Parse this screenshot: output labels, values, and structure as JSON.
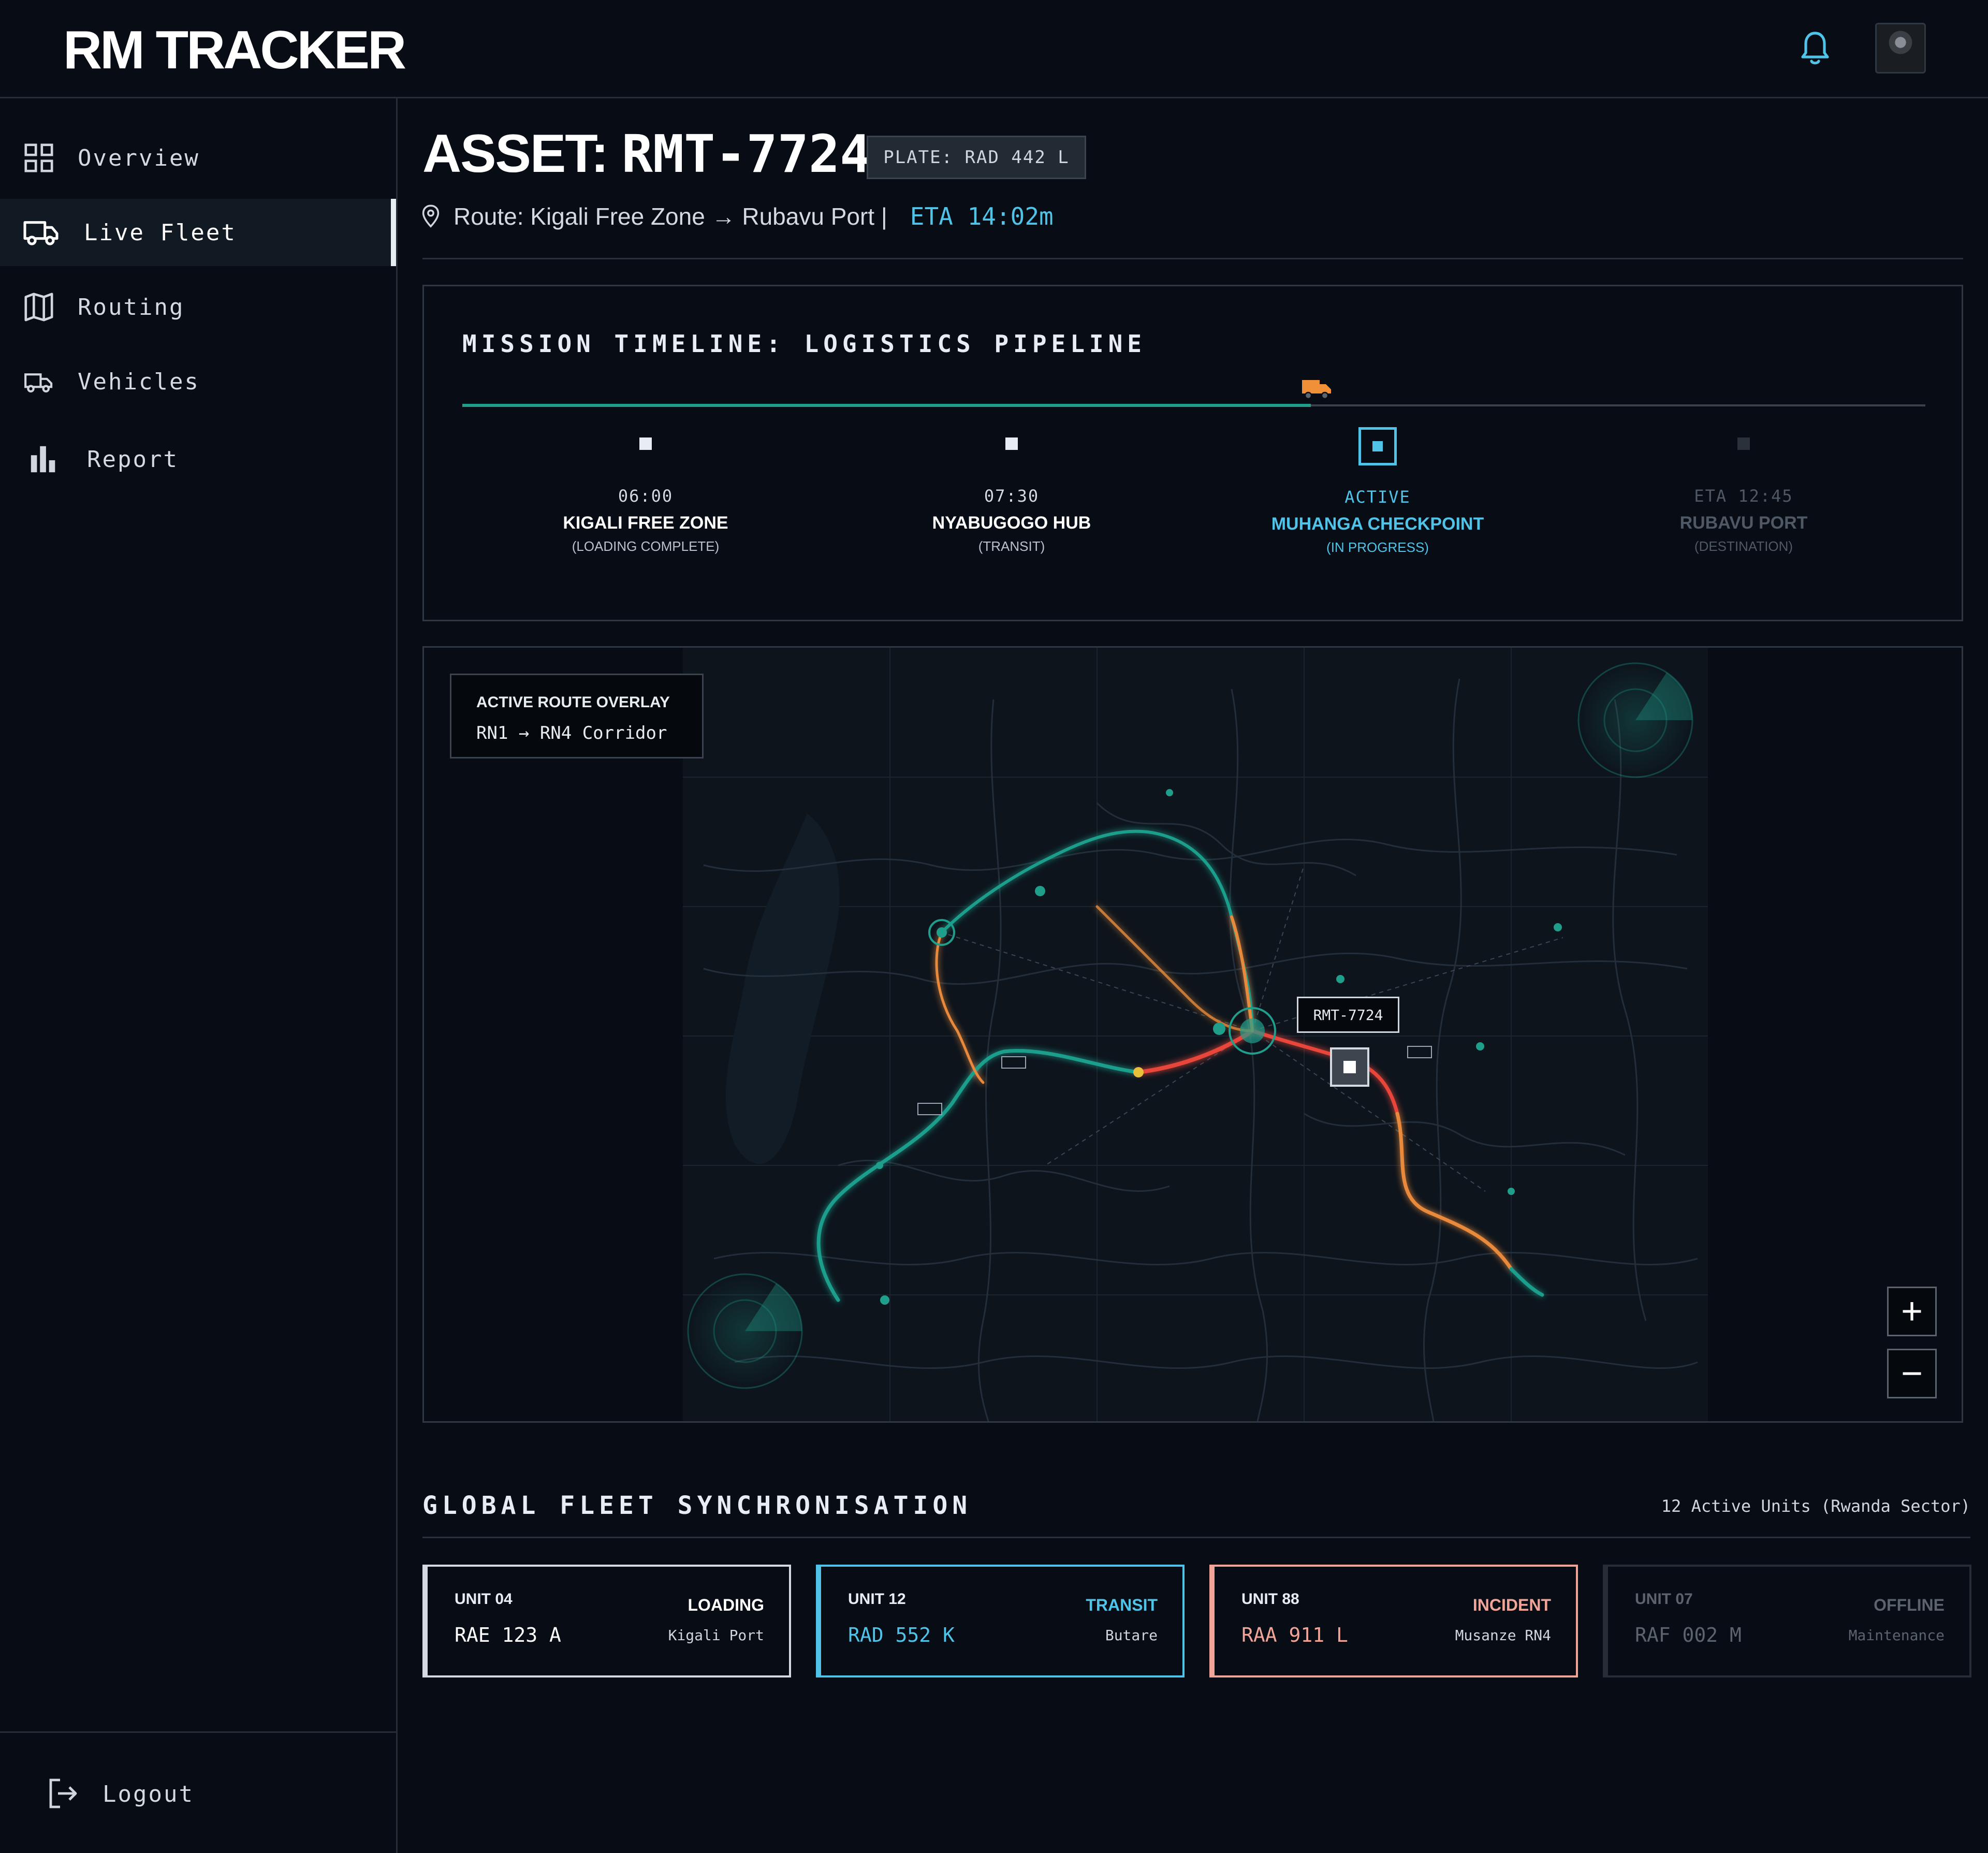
{
  "app": {
    "logo": "RM TRACKER"
  },
  "header": {
    "bell_icon": "bell-icon",
    "avatar": "user-avatar"
  },
  "sidebar": {
    "items": [
      {
        "label": "Overview",
        "icon": "grid-icon"
      },
      {
        "label": "Live Fleet",
        "icon": "truck-icon",
        "active": true
      },
      {
        "label": "Routing",
        "icon": "map-icon"
      },
      {
        "label": "Vehicles",
        "icon": "delivery-truck-icon"
      },
      {
        "label": "Report",
        "icon": "bar-chart-icon"
      }
    ],
    "logout_label": "Logout"
  },
  "asset": {
    "prefix": "ASSET: ",
    "id": "RMT-7724",
    "plate": "PLATE: RAD 442 L",
    "route": "Route: Kigali Free Zone → Rubavu Port |",
    "eta": "ETA 14:02m"
  },
  "timeline": {
    "title": "MISSION TIMELINE: LOGISTICS PIPELINE",
    "progress": 0.58,
    "stages": [
      {
        "time": "06:00",
        "name": "KIGALI FREE ZONE",
        "sub": "(LOADING COMPLETE)",
        "state": "done"
      },
      {
        "time": "07:30",
        "name": "NYABUGOGO HUB",
        "sub": "(TRANSIT)",
        "state": "done"
      },
      {
        "time": "ACTIVE",
        "name": "MUHANGA CHECKPOINT",
        "sub": "(IN PROGRESS)",
        "state": "active"
      },
      {
        "time": "ETA 12:45",
        "name": "RUBAVU PORT",
        "sub": "(DESTINATION)",
        "state": "pending"
      }
    ]
  },
  "map": {
    "overlay_title": "ACTIVE ROUTE OVERLAY",
    "overlay_route": "RN1 → RN4 Corridor",
    "asset_tag": "RMT-7724",
    "zoom_in": "+",
    "zoom_out": "−",
    "colors": {
      "route_teal": "#1f9e8c",
      "route_orange": "#e8893a",
      "route_red": "#e8453a"
    }
  },
  "fleet": {
    "title": "GLOBAL FLEET SYNCHRONISATION",
    "count": "12 Active Units (Rwanda Sector)",
    "units": [
      {
        "name": "UNIT 04",
        "plate": "RAE 123 A",
        "status": "LOADING",
        "location": "Kigali Port",
        "kind": "loading"
      },
      {
        "name": "UNIT 12",
        "plate": "RAD 552 K",
        "status": "TRANSIT",
        "location": "Butare",
        "kind": "transit"
      },
      {
        "name": "UNIT 88",
        "plate": "RAA 911 L",
        "status": "INCIDENT",
        "location": "Musanze RN4",
        "kind": "incident"
      },
      {
        "name": "UNIT 07",
        "plate": "RAF 002 M",
        "status": "OFFLINE",
        "location": "Maintenance",
        "kind": "offline"
      }
    ]
  },
  "colors": {
    "accent": "#4fc3e8",
    "incident": "#f0a598",
    "background": "#080c14"
  }
}
